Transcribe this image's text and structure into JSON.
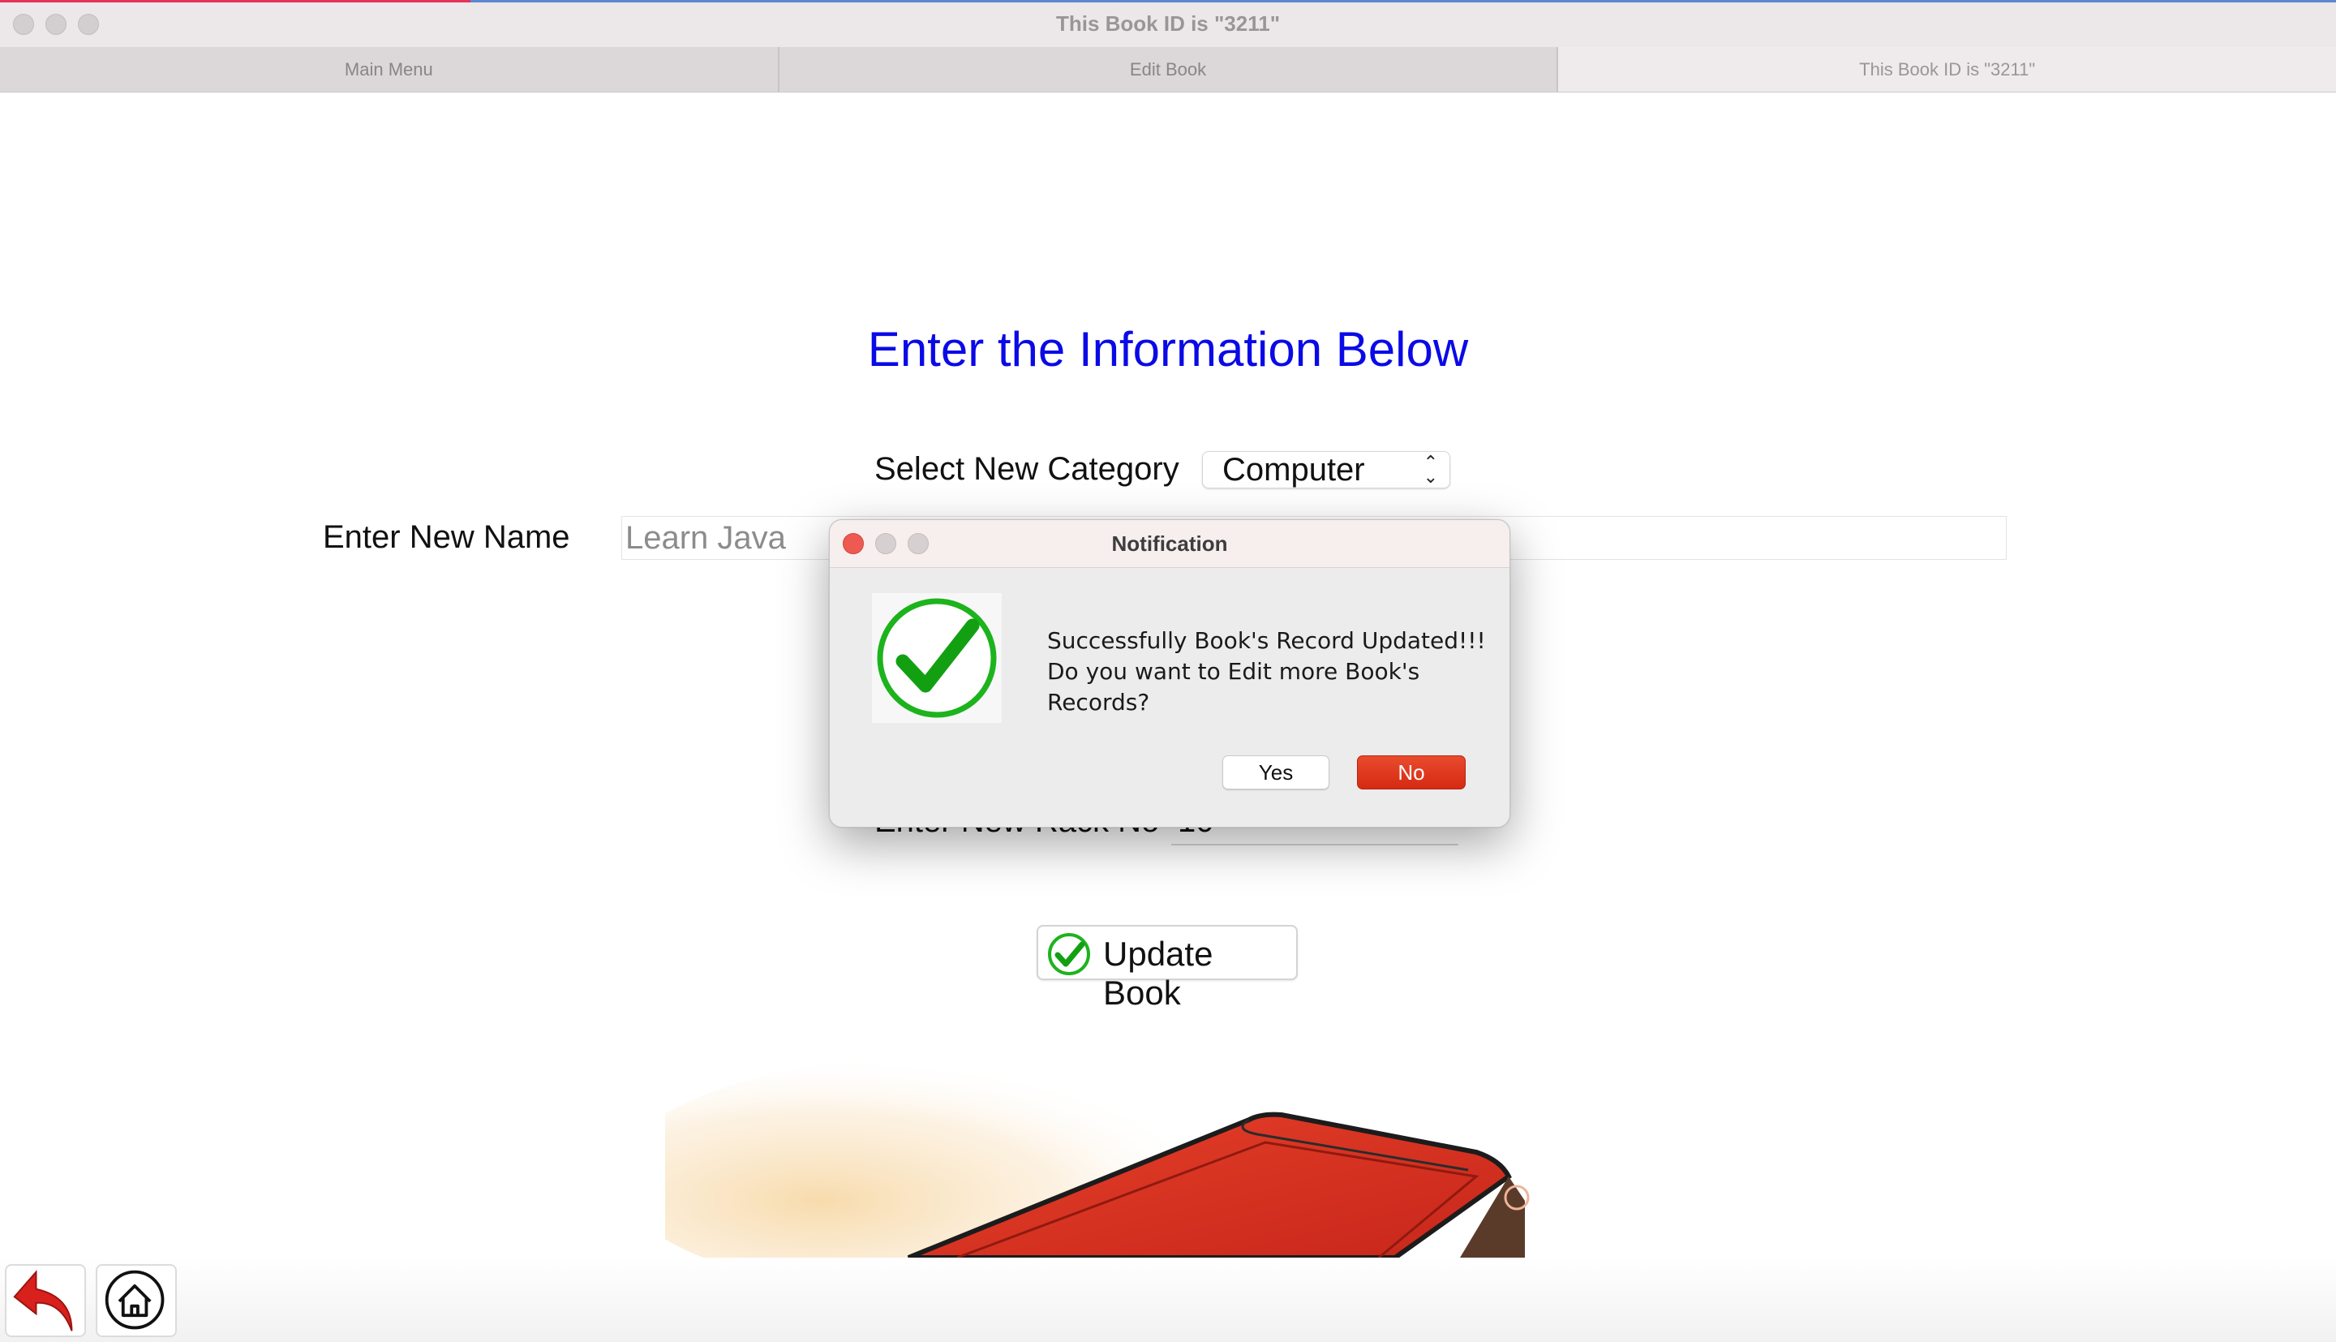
{
  "window": {
    "title": "This Book ID is \"3211\""
  },
  "tabs": [
    {
      "label": "Main Menu"
    },
    {
      "label": "Edit Book"
    },
    {
      "label": "This Book ID is \"3211\""
    }
  ],
  "form": {
    "heading": "Enter the Information Below",
    "category_label": "Select New Category",
    "category_value": "Computer",
    "name_label": "Enter New Name",
    "name_value": "Learn Java",
    "rack_label": "Enter New Rack No",
    "rack_value": "10",
    "update_button": "Update Book"
  },
  "dialog": {
    "title": "Notification",
    "line1": "Successfully Book's Record Updated!!!",
    "line2": "Do you want to Edit more Book's Records?",
    "yes_label": "Yes",
    "no_label": "No",
    "icon": "checkmark-circle-icon"
  },
  "bottom_nav": {
    "back_icon": "back-arrow-icon",
    "home_icon": "home-icon"
  },
  "colors": {
    "heading": "#0a0ae6",
    "check_green": "#1db31d",
    "no_button": "#d52a13",
    "close_dot": "#ee5a52",
    "back_arrow": "#d8201c"
  }
}
